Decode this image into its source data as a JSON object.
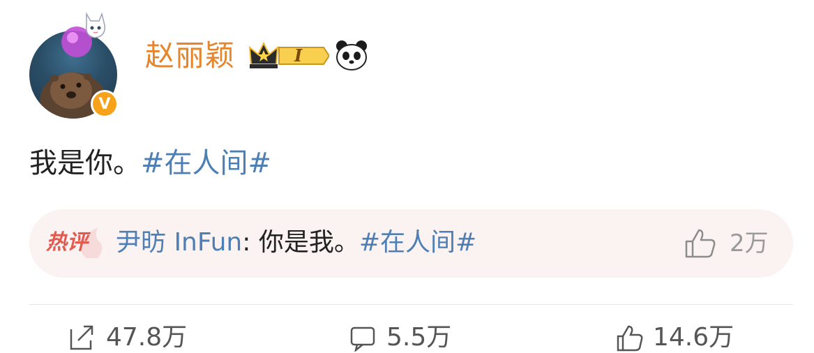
{
  "user": {
    "name": "赵丽颖",
    "vip_level": "I"
  },
  "post": {
    "text": "我是你。",
    "hashtag": "#在人间#"
  },
  "hot_comment": {
    "label": "热评",
    "user": "尹昉 InFun",
    "separator": ": ",
    "text": "你是我。",
    "hashtag": "#在人间#",
    "likes": "2万"
  },
  "actions": {
    "repost_count": "47.8万",
    "comment_count": "5.5万",
    "like_count": "14.6万"
  },
  "colors": {
    "username": "#e5852c",
    "link": "#4d7fb4",
    "verified": "#f7a21b",
    "hot_bg": "#fbf2f2"
  }
}
